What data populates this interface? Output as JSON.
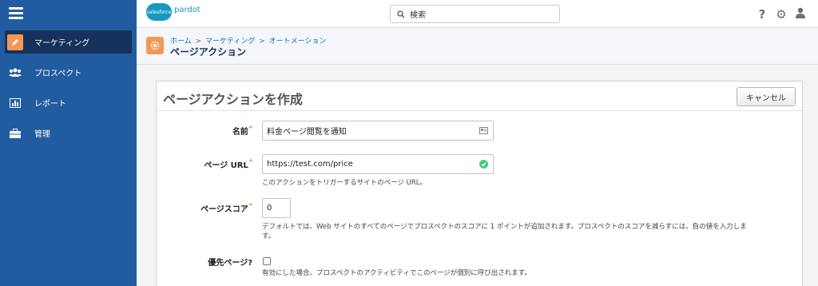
{
  "sidebar": {
    "items": [
      {
        "label": "マーケティング",
        "icon": "pencil-icon"
      },
      {
        "label": "プロスペクト",
        "icon": "users-icon"
      },
      {
        "label": "レポート",
        "icon": "chart-icon"
      },
      {
        "label": "管理",
        "icon": "briefcase-icon"
      }
    ]
  },
  "header": {
    "logo_cloud": "salesforce",
    "logo_text": "pardot",
    "search_placeholder": "検索",
    "icons": [
      "help-icon",
      "gear-icon",
      "user-icon"
    ]
  },
  "page_header": {
    "breadcrumb": [
      "ホーム",
      "マーケティング",
      "オートメーション"
    ],
    "separator": ">",
    "title": "ページアクション"
  },
  "form": {
    "title": "ページアクションを作成",
    "cancel_label": "キャンセル",
    "name_label": "名前",
    "name_value": "料金ページ閲覧を通知",
    "url_label": "ページ URL",
    "url_value": "https://test.com/price",
    "url_help": "このアクションをトリガーするサイトのページ URL。",
    "score_label": "ページスコア",
    "score_value": "0",
    "score_help_1": "デフォルトでは、Web サイトのすべてのページでプロスペクトのスコアに 1 ポイントが追加されます。プロスペクトのスコアを減らすには、負の値を入力しま",
    "score_help_2": "す。",
    "priority_label": "優先ページ?",
    "priority_checked": false,
    "priority_help": "有効にした場合、プロスペクトのアクティビティでこのページが個別に呼び出されます。",
    "required_mark": "*"
  },
  "colors": {
    "sidebar": "#215ca0",
    "sidebar_active": "#16325c",
    "accent_orange": "#f49756",
    "link": "#0070d2",
    "valid_green": "#4bca81"
  }
}
